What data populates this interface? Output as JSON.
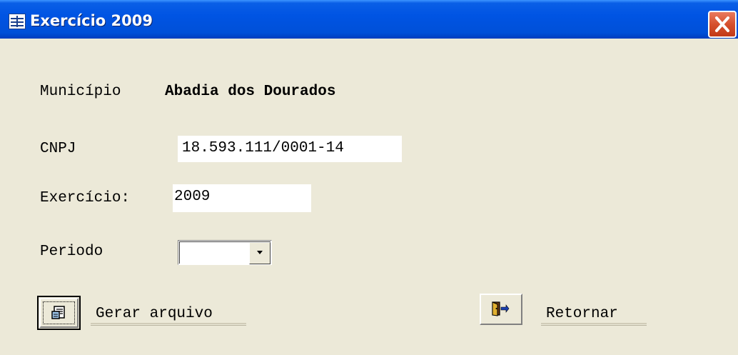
{
  "window": {
    "title": "Exercício 2009",
    "icon": "form-icon",
    "close_icon": "close-icon"
  },
  "form": {
    "municipio_label": "Município",
    "municipio_value": "Abadia dos Dourados",
    "cnpj_label": "CNPJ",
    "cnpj_value": "18.593.111/0001-14",
    "exercicio_label": "Exercício:",
    "exercicio_value": "2009",
    "periodo_label": "Periodo",
    "periodo_value": ""
  },
  "actions": {
    "gerar_label": "Gerar arquivo",
    "gerar_icon": "generate-file-icon",
    "retornar_label": "Retornar",
    "retornar_icon": "exit-door-icon"
  },
  "colors": {
    "titlebar": "#0054e3",
    "background": "#ece9d8",
    "close": "#d6502e"
  }
}
